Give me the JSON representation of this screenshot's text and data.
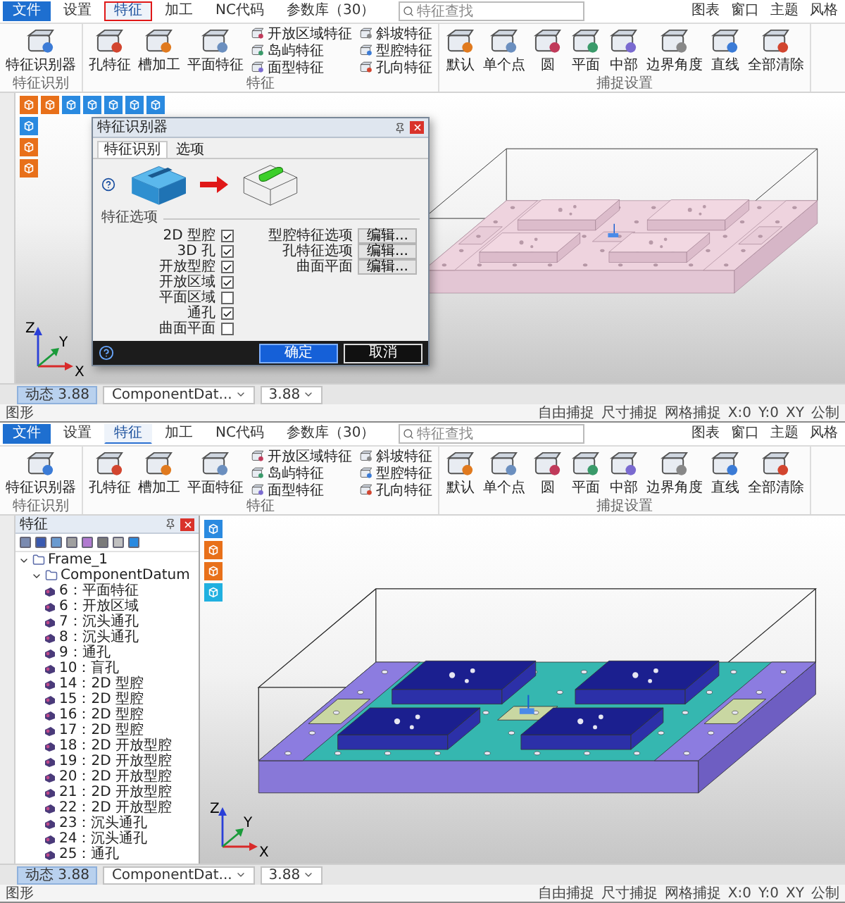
{
  "windows": [
    {
      "menu": {
        "tabs": [
          {
            "label": "文件",
            "kind": "file",
            "selected": false,
            "highlighted": false
          },
          {
            "label": "设置",
            "kind": "tab",
            "selected": false,
            "highlighted": false
          },
          {
            "label": "特征",
            "kind": "tab",
            "selected": true,
            "highlighted": true
          },
          {
            "label": "加工",
            "kind": "tab",
            "selected": false,
            "highlighted": false
          },
          {
            "label": "NC代码",
            "kind": "tab",
            "selected": false,
            "highlighted": false
          },
          {
            "label": "参数库（30）",
            "kind": "tab",
            "selected": false,
            "highlighted": false
          }
        ],
        "search": {
          "placeholder": "特征查找"
        },
        "right": [
          "图表",
          "窗口",
          "主题",
          "风格"
        ]
      },
      "ribbon": [
        {
          "label": "特征识别",
          "items": [
            {
              "kind": "large",
              "labels": [
                "特征识别器"
              ]
            }
          ]
        },
        {
          "label": "特征",
          "items": [
            {
              "kind": "large",
              "labels": [
                "孔特征"
              ]
            },
            {
              "kind": "large",
              "labels": [
                "槽加工"
              ]
            },
            {
              "kind": "large",
              "labels": [
                "平面特征"
              ]
            },
            {
              "kind": "stack",
              "labels": [
                "开放区域特征",
                "岛屿特征",
                "面型特征"
              ]
            },
            {
              "kind": "stack",
              "labels": [
                "斜坡特征",
                "型腔特征",
                "孔向特征"
              ]
            }
          ]
        },
        {
          "label": "捕捉设置",
          "items": [
            {
              "kind": "large",
              "labels": [
                "默认"
              ]
            },
            {
              "kind": "large",
              "labels": [
                "单个点"
              ]
            },
            {
              "kind": "large",
              "labels": [
                "圆"
              ]
            },
            {
              "kind": "large",
              "labels": [
                "平面"
              ]
            },
            {
              "kind": "large",
              "labels": [
                "中部"
              ]
            },
            {
              "kind": "large",
              "labels": [
                "边界角度"
              ]
            },
            {
              "kind": "large",
              "labels": [
                "直线"
              ]
            },
            {
              "kind": "large",
              "labels": [
                "全部清除"
              ]
            }
          ]
        }
      ],
      "dialog": {
        "title": "特征识别器",
        "tabs": [
          {
            "label": "特征识别",
            "selected": true
          },
          {
            "label": "选项",
            "selected": false
          }
        ],
        "section": "特征选项",
        "options": [
          {
            "label": "2D 型腔",
            "checked": true
          },
          {
            "label": "3D 孔",
            "checked": true
          },
          {
            "label": "开放型腔",
            "checked": true
          },
          {
            "label": "开放区域",
            "checked": true
          },
          {
            "label": "平面区域",
            "checked": false
          },
          {
            "label": "通孔",
            "checked": true
          },
          {
            "label": "曲面平面",
            "checked": false
          }
        ],
        "settings": [
          {
            "label": "型腔特征选项",
            "button": "编辑..."
          },
          {
            "label": "孔特征选项",
            "button": "编辑..."
          },
          {
            "label": "曲面平面",
            "button": "编辑..."
          }
        ],
        "buttons": [
          {
            "label": "确定",
            "kind": "primary"
          },
          {
            "label": "取消",
            "kind": "secondary"
          }
        ]
      },
      "model": {
        "kind": "unrecognized"
      },
      "axes": {
        "x": "X",
        "y": "Y",
        "z": "Z"
      },
      "doc_tabs": [
        {
          "label": "动态 3.88",
          "kind": "tab",
          "selected": true
        },
        {
          "label": "ComponentDat...",
          "kind": "combo",
          "selected": false
        },
        {
          "label": "3.88",
          "kind": "combo",
          "selected": false
        }
      ],
      "status": {
        "left": "图形",
        "items": [
          "自由捕捉",
          "尺寸捕捉",
          "网格捕捉",
          "X:0",
          "Y:0",
          "XY",
          "公制"
        ]
      }
    },
    {
      "menu": {
        "tabs": [
          {
            "label": "文件",
            "kind": "file",
            "selected": false,
            "highlighted": false
          },
          {
            "label": "设置",
            "kind": "tab",
            "selected": false,
            "highlighted": false
          },
          {
            "label": "特征",
            "kind": "tab",
            "selected": true,
            "highlighted": false
          },
          {
            "label": "加工",
            "kind": "tab",
            "selected": false,
            "highlighted": false
          },
          {
            "label": "NC代码",
            "kind": "tab",
            "selected": false,
            "highlighted": false
          },
          {
            "label": "参数库（30）",
            "kind": "tab",
            "selected": false,
            "highlighted": false
          }
        ],
        "search": {
          "placeholder": "特征查找"
        },
        "right": [
          "图表",
          "窗口",
          "主题",
          "风格"
        ]
      },
      "ribbon": [
        {
          "label": "特征识别",
          "items": [
            {
              "kind": "large",
              "labels": [
                "特征识别器"
              ]
            }
          ]
        },
        {
          "label": "特征",
          "items": [
            {
              "kind": "large",
              "labels": [
                "孔特征"
              ]
            },
            {
              "kind": "large",
              "labels": [
                "槽加工"
              ]
            },
            {
              "kind": "large",
              "labels": [
                "平面特征"
              ]
            },
            {
              "kind": "stack",
              "labels": [
                "开放区域特征",
                "岛屿特征",
                "面型特征"
              ]
            },
            {
              "kind": "stack",
              "labels": [
                "斜坡特征",
                "型腔特征",
                "孔向特征"
              ]
            }
          ]
        },
        {
          "label": "捕捉设置",
          "items": [
            {
              "kind": "large",
              "labels": [
                "默认"
              ]
            },
            {
              "kind": "large",
              "labels": [
                "单个点"
              ]
            },
            {
              "kind": "large",
              "labels": [
                "圆"
              ]
            },
            {
              "kind": "large",
              "labels": [
                "平面"
              ]
            },
            {
              "kind": "large",
              "labels": [
                "中部"
              ]
            },
            {
              "kind": "large",
              "labels": [
                "边界角度"
              ]
            },
            {
              "kind": "large",
              "labels": [
                "直线"
              ]
            },
            {
              "kind": "large",
              "labels": [
                "全部清除"
              ]
            }
          ]
        }
      ],
      "tree": {
        "title": "特征",
        "nodes": [
          {
            "label": "Frame_1",
            "expanded": true,
            "children": [
              {
                "label": "ComponentDatum",
                "expanded": true,
                "children": [
                  {
                    "label": "6：平面特征"
                  },
                  {
                    "label": "6：开放区域"
                  },
                  {
                    "label": "7：沉头通孔"
                  },
                  {
                    "label": "8：沉头通孔"
                  },
                  {
                    "label": "9：通孔"
                  },
                  {
                    "label": "10：盲孔"
                  },
                  {
                    "label": "14：2D 型腔"
                  },
                  {
                    "label": "15：2D 型腔"
                  },
                  {
                    "label": "16：2D 型腔"
                  },
                  {
                    "label": "17：2D 型腔"
                  },
                  {
                    "label": "18：2D 开放型腔"
                  },
                  {
                    "label": "19：2D 开放型腔"
                  },
                  {
                    "label": "20：2D 开放型腔"
                  },
                  {
                    "label": "21：2D 开放型腔"
                  },
                  {
                    "label": "22：2D 开放型腔"
                  },
                  {
                    "label": "23：沉头通孔"
                  },
                  {
                    "label": "24：沉头通孔"
                  },
                  {
                    "label": "25：通孔"
                  }
                ]
              }
            ]
          }
        ]
      },
      "model": {
        "kind": "recognized"
      },
      "axes": {
        "x": "X",
        "y": "Y",
        "z": "Z"
      },
      "doc_tabs": [
        {
          "label": "动态 3.88",
          "kind": "tab",
          "selected": true
        },
        {
          "label": "ComponentDat...",
          "kind": "combo",
          "selected": false
        },
        {
          "label": "3.88",
          "kind": "combo",
          "selected": false
        }
      ],
      "status": {
        "left": "图形",
        "items": [
          "自由捕捉",
          "尺寸捕捉",
          "网格捕捉",
          "X:0",
          "Y:0",
          "XY",
          "公制"
        ]
      }
    }
  ]
}
